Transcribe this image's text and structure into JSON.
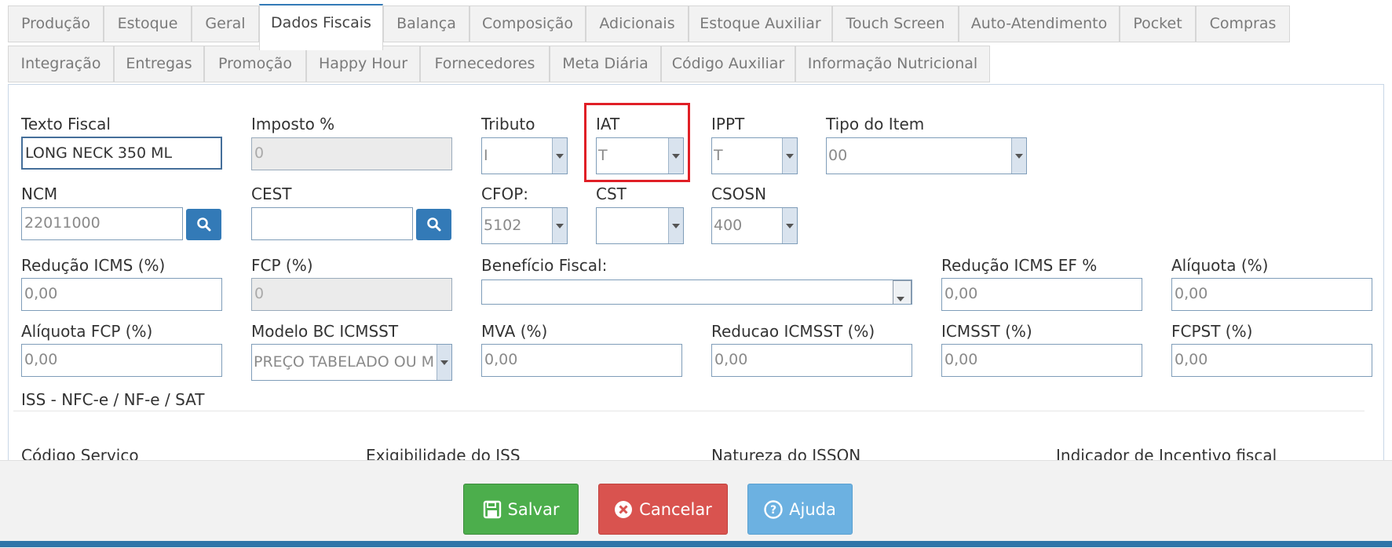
{
  "tabs": {
    "row1": [
      "Produção",
      "Estoque",
      "Geral",
      "Dados Fiscais",
      "Balança",
      "Composição",
      "Adicionais",
      "Estoque Auxiliar",
      "Touch Screen",
      "Auto-Atendimento",
      "Pocket",
      "Compras"
    ],
    "row2": [
      "Integração",
      "Entregas",
      "Promoção",
      "Happy Hour",
      "Fornecedores",
      "Meta Diária",
      "Código Auxiliar",
      "Informação Nutricional"
    ],
    "active": "Dados Fiscais"
  },
  "form": {
    "texto_fiscal": {
      "label": "Texto Fiscal",
      "value": "LONG NECK 350 ML"
    },
    "imposto": {
      "label": "Imposto %",
      "value": "0"
    },
    "tributo": {
      "label": "Tributo",
      "value": "I"
    },
    "iat": {
      "label": "IAT",
      "value": "T"
    },
    "ippt": {
      "label": "IPPT",
      "value": "T"
    },
    "tipo_item": {
      "label": "Tipo do Item",
      "value": "00"
    },
    "ncm": {
      "label": "NCM",
      "value": "22011000"
    },
    "cest": {
      "label": "CEST",
      "value": ""
    },
    "cfop": {
      "label": "CFOP:",
      "value": "5102"
    },
    "cst": {
      "label": "CST",
      "value": ""
    },
    "csosn": {
      "label": "CSOSN",
      "value": "400"
    },
    "reducao_icms": {
      "label": "Redução ICMS (%)",
      "value": "0,00"
    },
    "fcp": {
      "label": "FCP (%)",
      "value": "0"
    },
    "beneficio_fiscal": {
      "label": "Benefício Fiscal:",
      "value": ""
    },
    "reducao_icms_ef": {
      "label": "Redução ICMS EF %",
      "value": "0,00"
    },
    "aliquota": {
      "label": "Alíquota (%)",
      "value": "0,00"
    },
    "aliquota_fcp": {
      "label": "Alíquota FCP (%)",
      "value": "0,00"
    },
    "modelo_bc": {
      "label": "Modelo BC ICMSST",
      "value": "PREÇO TABELADO OU M"
    },
    "mva": {
      "label": "MVA (%)",
      "value": "0,00"
    },
    "reducao_icmsst": {
      "label": "Reducao ICMSST (%)",
      "value": "0,00"
    },
    "icmsst": {
      "label": "ICMSST (%)",
      "value": "0,00"
    },
    "fcpst": {
      "label": "FCPST (%)",
      "value": "0,00"
    },
    "iss_section": "ISS - NFC-e / NF-e / SAT",
    "codigo_servico": "Código Servico",
    "exigibilidade_iss": "Exigibilidade do ISS",
    "natureza_issqn": "Natureza do ISSQN",
    "indicador_incentivo": "Indicador de Incentivo fiscal"
  },
  "buttons": {
    "save": "Salvar",
    "cancel": "Cancelar",
    "help": "Ajuda"
  },
  "colors": {
    "save": "#4cae4c",
    "cancel": "#d9534f",
    "help": "#6cb1e1",
    "highlight": "#e01f26",
    "accent": "#337ab7"
  }
}
